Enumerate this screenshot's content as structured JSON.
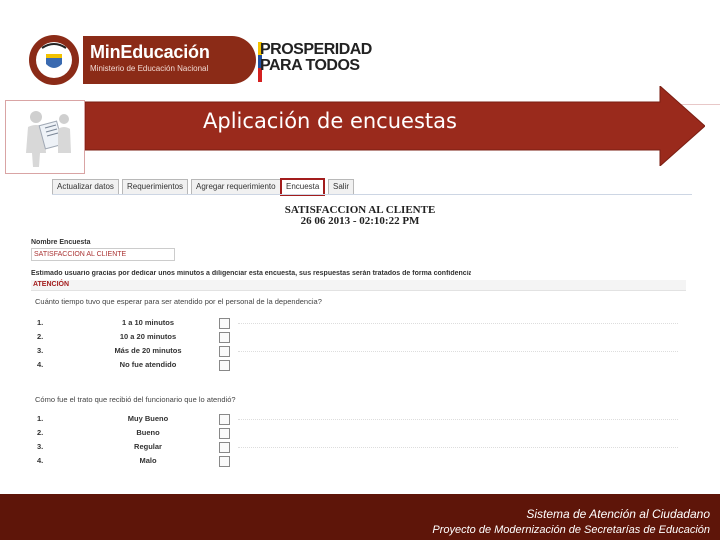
{
  "header": {
    "ministry_brand": "MinEducación",
    "ministry_subtitle": "Ministerio de Educación Nacional",
    "seal_text": "REPÚBLICA DE COLOMBIA",
    "slogan_line1": "PROSPERIDAD",
    "slogan_line2": "PARA TODOS"
  },
  "banner": {
    "title": "Aplicación de encuestas",
    "color": "#9a2a1c"
  },
  "app": {
    "tabs": [
      {
        "label": "Actualizar datos",
        "active": false
      },
      {
        "label": "Requerimientos",
        "active": false
      },
      {
        "label": "Agregar requerimiento",
        "active": false
      },
      {
        "label": "Encuesta",
        "active": true
      },
      {
        "label": "Salir",
        "active": false
      }
    ],
    "survey_title": "SATISFACCION AL CLIENTE",
    "survey_date": "26 06 2013 - 02:10:22 PM",
    "name_label": "Nombre Encuesta",
    "name_value": "SATISFACCION AL CLIENTE",
    "intro": "Estimado usuario gracias por dedicar unos minutos a diligenciar esta encuesta, sus respuestas serán tratados de forma confidencial",
    "section": "ATENCIÓN",
    "questions": [
      {
        "text": "Cuánto tiempo tuvo que esperar para ser atendido por el personal de la dependencia?",
        "options": [
          {
            "num": "1.",
            "label": "1 a 10 minutos"
          },
          {
            "num": "2.",
            "label": "10 a 20 minutos"
          },
          {
            "num": "3.",
            "label": "Más de 20 minutos"
          },
          {
            "num": "4.",
            "label": "No fue atendido"
          }
        ]
      },
      {
        "text": "Cómo fue el trato que recibió del funcionario que lo atendió?",
        "options": [
          {
            "num": "1.",
            "label": "Muy Bueno"
          },
          {
            "num": "2.",
            "label": "Bueno"
          },
          {
            "num": "3.",
            "label": "Regular"
          },
          {
            "num": "4.",
            "label": "Malo"
          }
        ]
      }
    ]
  },
  "footer": {
    "line1": "Sistema de Atención al Ciudadano",
    "line2": "Proyecto de Modernización de Secretarías de Educación",
    "color": "#5e1509"
  }
}
